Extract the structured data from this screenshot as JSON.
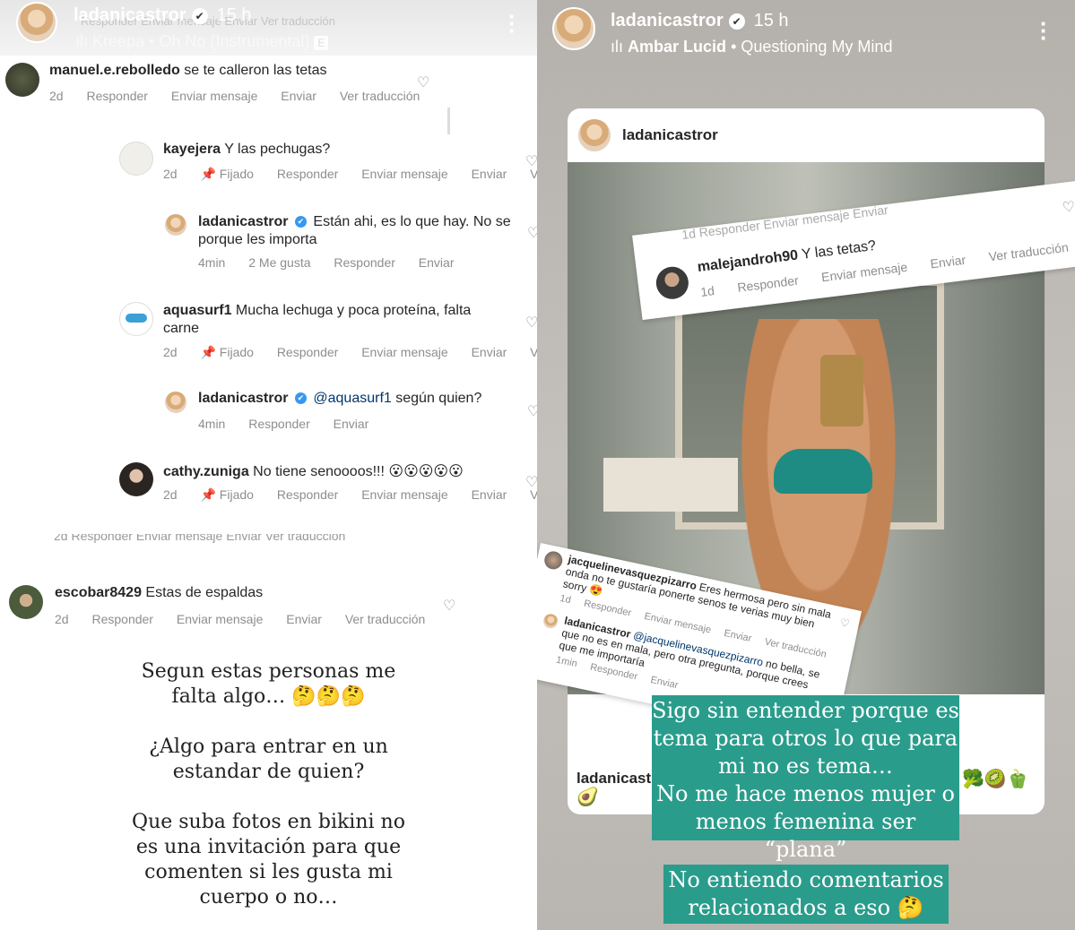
{
  "left_story": {
    "header": {
      "username": "ladanicastror",
      "time": "15 h",
      "music": "Kreepa • Oh No (Instrumental)",
      "music_badge": "E",
      "faded_actions": "Responder   Enviar mensaje   Enviar   Ver traducción"
    },
    "comments": [
      {
        "user": "manuel.e.rebolledo",
        "text": "se te calleron las tetas",
        "meta": [
          "2d",
          "Responder",
          "Enviar mensaje",
          "Enviar",
          "Ver traducción"
        ]
      },
      {
        "user": "kayejera",
        "text": "Y las pechugas?",
        "meta": [
          "2d",
          "📌 Fijado",
          "Responder",
          "Enviar mensaje",
          "Enviar",
          "Ve"
        ]
      },
      {
        "user": "ladanicastror",
        "text": "Están ahi, es lo que hay. No se porque les importa",
        "meta": [
          "4min",
          "2 Me gusta",
          "Responder",
          "Enviar"
        ]
      },
      {
        "user": "aquasurf1",
        "text": "Mucha lechuga y poca proteína,  falta carne",
        "meta": [
          "2d",
          "📌 Fijado",
          "Responder",
          "Enviar mensaje",
          "Enviar",
          "Ve"
        ]
      },
      {
        "user": "ladanicastror",
        "mention": "@aquasurf1",
        "text": "según quien?",
        "meta": [
          "4min",
          "Responder",
          "Enviar"
        ]
      },
      {
        "user": "cathy.zuniga",
        "text": "No tiene senoooos!!! 😮😮😮😮😮",
        "meta": [
          "2d",
          "📌 Fijado",
          "Responder",
          "Enviar mensaje",
          "Enviar",
          "Ve"
        ]
      },
      {
        "user": "escobar8429",
        "text": "Estas de espaldas",
        "meta": [
          "2d",
          "Responder",
          "Enviar mensaje",
          "Enviar",
          "Ver traducción"
        ]
      }
    ],
    "faded_meta_row": "2d   Responder   Enviar mensaje   Enviar   Ver traducción",
    "caption_lines": [
      "Segun estas personas me",
      "falta algo… 🤔🤔🤔",
      "",
      "¿Algo para entrar en un",
      "estandar de quien?",
      "",
      "Que suba fotos en bikini no",
      "es una invitación para que",
      "comenten si les gusta mi",
      "cuerpo o no…"
    ]
  },
  "right_story": {
    "header": {
      "username": "ladanicastror",
      "time": "15 h",
      "music_artist": "Ambar Lucid",
      "music_song": "Questioning My Mind"
    },
    "post": {
      "username": "ladanicastror",
      "caption_user_truncated": "ladanicast",
      "caption_emoji": "🥑",
      "trailing_emojis": "🥦🥝🫑"
    },
    "screenshot_top": {
      "faded_meta": "1d   Responder   Enviar mensaje   Enviar",
      "user": "malejandroh90",
      "text": "Y las tetas?",
      "meta": [
        "1d",
        "Responder",
        "Enviar mensaje",
        "Enviar",
        "Ver traducción"
      ]
    },
    "screenshot_bottom": {
      "comment1_user": "jacquelinevasquezpizarro",
      "comment1_text": "Eres hermosa pero sin mala onda no te gustaría ponerte senos te verias muy bien sorry 😍",
      "comment1_meta": [
        "1d",
        "Responder",
        "Enviar mensaje",
        "Enviar",
        "Ver traducción"
      ],
      "comment2_user": "ladanicastror",
      "comment2_mention": "@jacquelinevasquezpizarro",
      "comment2_text": "no bella, se que no es en mala, pero otra pregunta, porque crees que me importaría",
      "comment2_meta": [
        "1min",
        "Responder",
        "Enviar"
      ]
    },
    "teal_text_1": [
      "Sigo sin entender porque es",
      "tema para otros lo que para",
      "mi no es tema…",
      "No me hace menos mujer o",
      "menos femenina ser “plana”"
    ],
    "teal_text_2": [
      "No entiendo comentarios",
      "relacionados a eso 🤔"
    ]
  },
  "colors": {
    "teal": "#2a9c8c",
    "meta_gray": "#8e8e8e",
    "text_dark": "#262626"
  }
}
